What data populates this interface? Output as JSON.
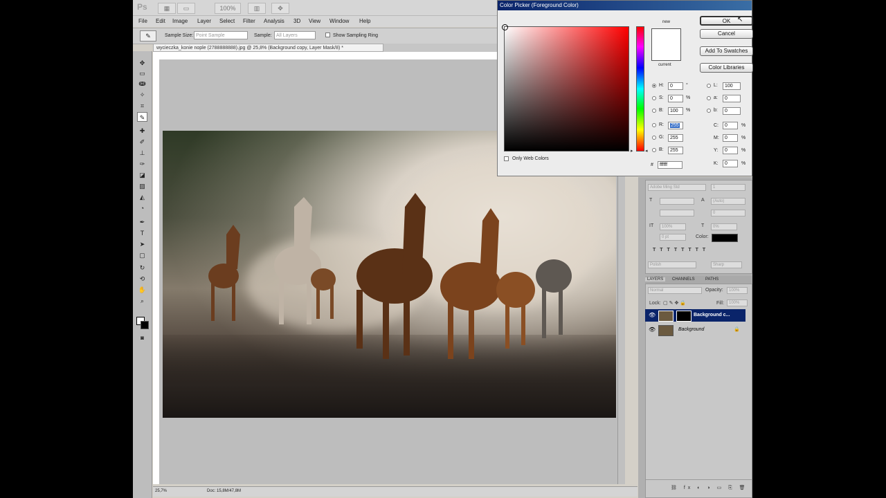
{
  "app": {
    "logo": "Ps",
    "toolbar_buttons": [
      "▦",
      "▭",
      "100%",
      "▥",
      "✥"
    ],
    "menus": [
      "File",
      "Edit",
      "Image",
      "Layer",
      "Select",
      "Filter",
      "Analysis",
      "3D",
      "View",
      "Window",
      "Help"
    ]
  },
  "options_bar": {
    "tool_icon": "eyedropper-icon",
    "sample_size_label": "Sample Size:",
    "sample_size_value": "Point Sample",
    "sample_label": "Sample:",
    "sample_value": "All Layers",
    "show_ring_label": "Show Sampling Ring",
    "show_ring_checked": true
  },
  "document": {
    "tab_title": "wycieczka_konie nople (2788888888).jpg @ 25,8% (Background copy, Layer Mask/8) *",
    "zoom": "25,7%",
    "doc_info": "Doc: 15,8M/47,8M"
  },
  "color_picker": {
    "title": "Color Picker (Foreground Color)",
    "new_label": "new",
    "current_label": "current",
    "buttons": {
      "ok": "OK",
      "cancel": "Cancel",
      "add_swatches": "Add To Swatches",
      "libraries": "Color Libraries"
    },
    "only_web_colors": "Only Web Colors",
    "hsb": [
      {
        "label": "H:",
        "value": "0",
        "unit": "°",
        "selected": true
      },
      {
        "label": "S:",
        "value": "0",
        "unit": "%",
        "selected": false
      },
      {
        "label": "B:",
        "value": "100",
        "unit": "%",
        "selected": false
      }
    ],
    "rgb": [
      {
        "label": "R:",
        "value": "255",
        "selected": false
      },
      {
        "label": "G:",
        "value": "255",
        "selected": false
      },
      {
        "label": "B:",
        "value": "255",
        "selected": false
      }
    ],
    "lab": [
      {
        "label": "L:",
        "value": "100"
      },
      {
        "label": "a:",
        "value": "0"
      },
      {
        "label": "b:",
        "value": "0"
      }
    ],
    "cmyk": [
      {
        "label": "C:",
        "value": "0",
        "unit": "%"
      },
      {
        "label": "M:",
        "value": "0",
        "unit": "%"
      },
      {
        "label": "Y:",
        "value": "0",
        "unit": "%"
      },
      {
        "label": "K:",
        "value": "0",
        "unit": "%"
      }
    ],
    "hex_label": "#",
    "hex_value": "ffffff",
    "new_color": "#ffffff"
  },
  "character_panel": {
    "font": "Adobe Ming Std",
    "size": "1",
    "leading": "(Auto)",
    "tracking": "0",
    "scale_v": "100%",
    "scale_h": "0%",
    "baseline": "0 pt",
    "color_label": "Color:",
    "lang": "Polish",
    "aa": "Sharp"
  },
  "layers_panel": {
    "tabs": [
      "LAYERS",
      "CHANNELS",
      "PATHS"
    ],
    "blend_mode": "Normal",
    "opacity_label": "Opacity:",
    "opacity_value": "100%",
    "lock_label": "Lock:",
    "fill_label": "Fill:",
    "fill_value": "100%",
    "layers": [
      {
        "name": "Background c...",
        "selected": true
      },
      {
        "name": "Background",
        "selected": false
      }
    ]
  }
}
